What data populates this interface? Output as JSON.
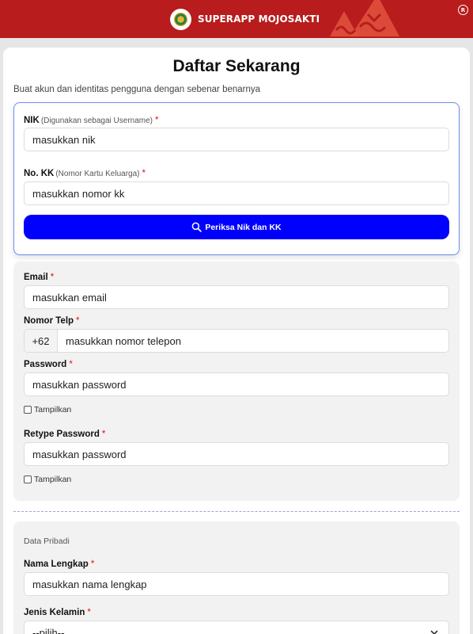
{
  "header": {
    "app_name": "SUPERAPP MOJOSAKTI",
    "logo_icon": "kabupaten-emblem-icon",
    "corner_icon": "registered-icon",
    "background_color": "#b81c1c"
  },
  "page": {
    "title": "Daftar Sekarang",
    "subtitle": "Buat akun dan identitas pengguna dengan sebenar benarnya"
  },
  "verification": {
    "nik": {
      "label": "NIK",
      "hint": "(Digunakan sebagai Username)",
      "required_mark": "*",
      "placeholder": "masukkan nik"
    },
    "kk": {
      "label": "No. KK",
      "hint": "(Nomor Kartu Keluarga)",
      "required_mark": "*",
      "placeholder": "masukkan nomor kk"
    },
    "check_button": {
      "label": "Periksa Nik dan KK",
      "icon": "search-icon",
      "color": "#0000ff"
    }
  },
  "account": {
    "email": {
      "label": "Email",
      "required_mark": "*",
      "placeholder": "masukkan email"
    },
    "phone": {
      "label": "Nomor Telp",
      "required_mark": "*",
      "prefix": "+62",
      "placeholder": "masukkan nomor telepon"
    },
    "password": {
      "label": "Password",
      "required_mark": "*",
      "placeholder": "masukkan password",
      "show_label": "Tampilkan"
    },
    "retype_password": {
      "label": "Retype Password",
      "required_mark": "*",
      "placeholder": "masukkan password",
      "show_label": "Tampilkan"
    }
  },
  "personal": {
    "section_title": "Data Pribadi",
    "full_name": {
      "label": "Nama Lengkap",
      "required_mark": "*",
      "placeholder": "masukkan nama lengkap"
    },
    "gender": {
      "label": "Jenis Kelamin",
      "required_mark": "*",
      "selected": "--pilih--"
    }
  }
}
